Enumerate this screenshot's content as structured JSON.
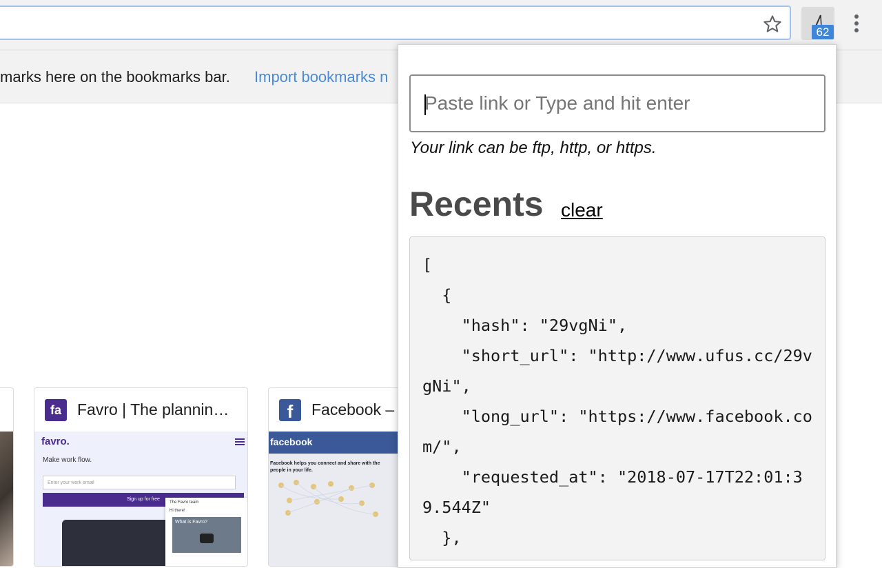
{
  "bookmarks_bar": {
    "message": "marks here on the bookmarks bar.",
    "import_link": "Import bookmarks n"
  },
  "extension": {
    "badge_count": "62"
  },
  "tiles": [
    {
      "title": "Favro | The plannin…",
      "favicon": "favro-icon",
      "thumb_brand": "favro.",
      "thumb_headline": "Make work flow.",
      "thumb_email_placeholder": "Enter your work email",
      "thumb_cta": "Sign up for free",
      "thumb_chat_title": "The Favro team",
      "thumb_chat_msg": "Hi there!",
      "thumb_video": "What is Favro?"
    },
    {
      "title": "Facebook –",
      "favicon": "facebook-icon",
      "thumb_brand": "facebook",
      "thumb_text": "Facebook helps you connect and share with the people in your life."
    }
  ],
  "popup": {
    "input_placeholder": "Paste link or Type and hit enter",
    "hint": "Your link can be ftp, http, or https.",
    "recents_heading": "Recents",
    "clear_label": "clear",
    "recents_json": "[\n  {\n    \"hash\": \"29vgNi\",\n    \"short_url\": \"http://www.ufus.cc/29vgNi\",\n    \"long_url\": \"https://www.facebook.com/\",\n    \"requested_at\": \"2018-07-17T22:01:39.544Z\"\n  },"
  },
  "colors": {
    "accent_link": "#4a8ad9",
    "badge": "#3f85d8",
    "favro_purple": "#4a2c8f",
    "facebook_blue": "#3b5998"
  }
}
